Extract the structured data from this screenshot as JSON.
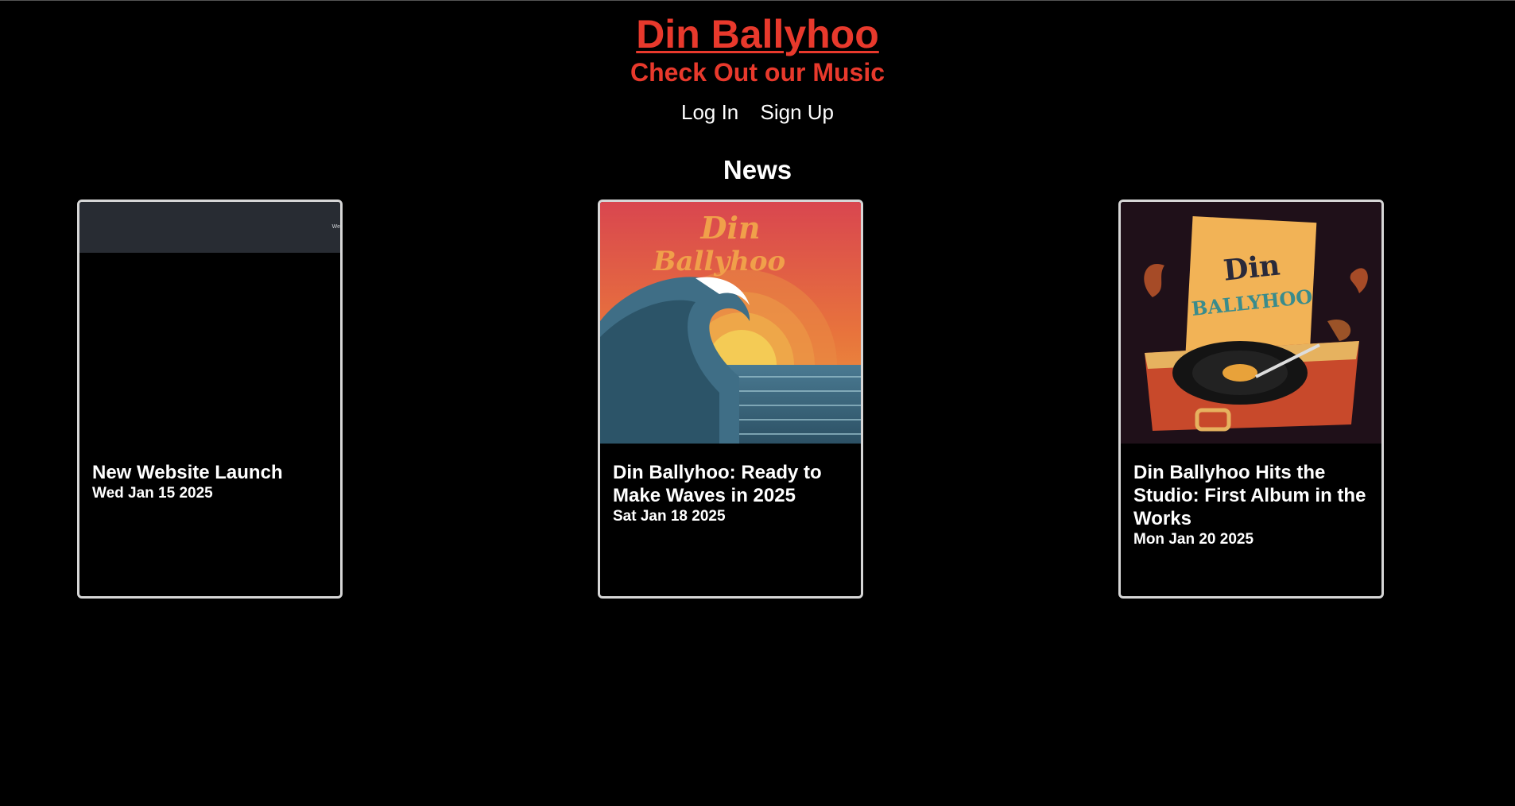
{
  "header": {
    "title": "Din Ballyhoo",
    "tagline": "Check Out our Music"
  },
  "auth": {
    "login_label": "Log In",
    "signup_label": "Sign Up"
  },
  "news": {
    "heading": "News",
    "items": [
      {
        "headline": "New Website Launch",
        "date": "Wed Jan 15 2025",
        "image": "website-screenshot-thumbnail"
      },
      {
        "headline": "Din Ballyhoo: Ready to Make Waves in 2025",
        "date": "Sat Jan 18 2025",
        "image": "wave-sunset-band-logo-artwork"
      },
      {
        "headline": "Din Ballyhoo Hits the Studio: First Album in the Works",
        "date": "Mon Jan 20 2025",
        "image": "record-player-album-artwork"
      }
    ]
  },
  "colors": {
    "background": "#000000",
    "accent": "#e8392c",
    "text": "#ffffff",
    "card_border": "#d6d6d6"
  }
}
